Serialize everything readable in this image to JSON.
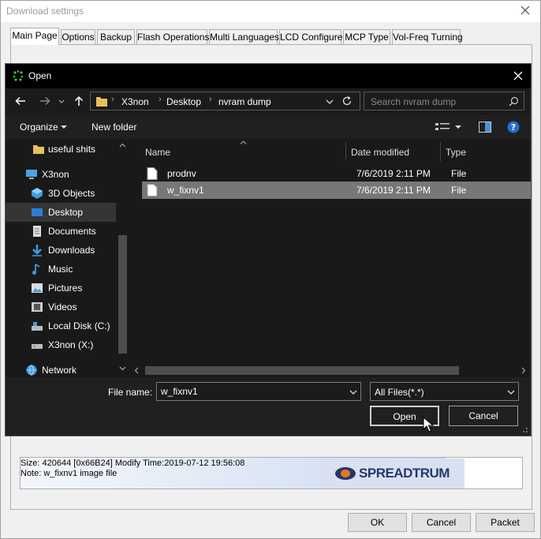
{
  "background_window": {
    "title": "Download settings",
    "tabs": [
      "Main Page",
      "Options",
      "Backup",
      "Flash Operations",
      "Multi Languages",
      "LCD Configure",
      "MCP Type",
      "Vol-Freq Turning"
    ],
    "active_tab": "Main Page",
    "info_line1": "Size: 420644   [0x66B24] Modify Time:2019-07-12 19:56:08",
    "info_line2": "Note: w_fixnv1 image file",
    "logo_text": "SPREADTRUM",
    "ok_label": "OK",
    "cancel_label": "Cancel",
    "packet_label": "Packet"
  },
  "dialog": {
    "title": "Open",
    "breadcrumb": [
      "X3non",
      "Desktop",
      "nvram dump"
    ],
    "search_placeholder": "Search nvram dump",
    "organize_label": "Organize",
    "new_folder_label": "New folder",
    "sidebar": [
      {
        "label": "useful shits",
        "icon": "folder-icon"
      },
      {
        "label": "X3non",
        "icon": "computer-icon"
      },
      {
        "label": "3D Objects",
        "icon": "3d-objects-icon"
      },
      {
        "label": "Desktop",
        "icon": "desktop-icon",
        "selected": true
      },
      {
        "label": "Documents",
        "icon": "documents-icon"
      },
      {
        "label": "Downloads",
        "icon": "downloads-icon"
      },
      {
        "label": "Music",
        "icon": "music-icon"
      },
      {
        "label": "Pictures",
        "icon": "pictures-icon"
      },
      {
        "label": "Videos",
        "icon": "videos-icon"
      },
      {
        "label": "Local Disk (C:)",
        "icon": "local-disk-icon"
      },
      {
        "label": "X3non (X:)",
        "icon": "network-drive-icon"
      },
      {
        "label": "Network",
        "icon": "network-icon"
      }
    ],
    "columns": {
      "name": "Name",
      "date": "Date modified",
      "type": "Type"
    },
    "files": [
      {
        "name": "prodnv",
        "date": "7/6/2019 2:11 PM",
        "type": "File"
      },
      {
        "name": "w_fixnv1",
        "date": "7/6/2019 2:11 PM",
        "type": "File",
        "selected": true
      }
    ],
    "file_name_label": "File name:",
    "file_name_value": "w_fixnv1",
    "filter_value": "All Files(*.*)",
    "open_label": "Open",
    "cancel_label": "Cancel"
  },
  "colors": {
    "dialog_bg": "#202020",
    "nav_pane_bg": "#191919",
    "selection": "#777777",
    "accent": "#0078d7",
    "logo_blue": "#24386c",
    "logo_orange": "#e87722"
  }
}
